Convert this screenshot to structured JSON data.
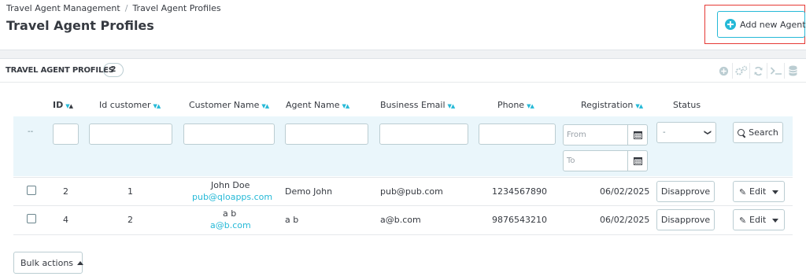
{
  "breadcrumb": {
    "parent": "Travel Agent Management",
    "separator": "/",
    "current": "Travel Agent Profiles"
  },
  "page_title": "Travel Agent Profiles",
  "add_button": {
    "label": "Add new Agent",
    "icon": "plus-circle-icon"
  },
  "panel": {
    "title": "Travel Agent Profiles",
    "count": "2",
    "toolbar_icons": [
      "add-icon",
      "settings-icon",
      "refresh-icon",
      "sql-query-icon",
      "database-icon"
    ]
  },
  "columns": {
    "id": "ID",
    "id_customer": "Id customer",
    "customer_name": "Customer Name",
    "agent_name": "Agent Name",
    "business_email": "Business Email",
    "phone": "Phone",
    "registration": "Registration",
    "status": "Status",
    "sort_arrows": "▼▲"
  },
  "filters": {
    "dash": "--",
    "from_placeholder": "From",
    "to_placeholder": "To",
    "status_value": "-",
    "status_chevron": "❯",
    "search_label": "Search"
  },
  "rows": [
    {
      "id": "2",
      "id_customer": "1",
      "customer_name": "John Doe",
      "customer_email": "pub@qloapps.com",
      "agent_name": "Demo John",
      "business_email": "pub@pub.com",
      "phone": "1234567890",
      "registration": "06/02/2025",
      "status_button": "Disapprove",
      "edit_label": "Edit"
    },
    {
      "id": "4",
      "id_customer": "2",
      "customer_name": "a b",
      "customer_email": "a@b.com",
      "agent_name": "a b",
      "business_email": "a@b.com",
      "phone": "9876543210",
      "registration": "06/02/2025",
      "status_button": "Disapprove",
      "edit_label": "Edit"
    }
  ],
  "bulk_actions": "Bulk actions",
  "colors": {
    "accent": "#25b9d7",
    "highlight": "#e53935",
    "filter_bg": "#eaf6fb",
    "text": "#363a41"
  }
}
